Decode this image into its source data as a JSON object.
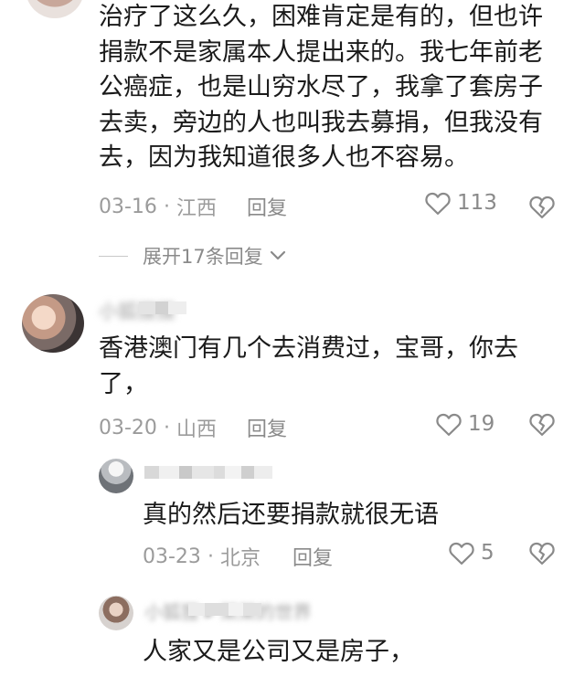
{
  "comments": [
    {
      "text": "治疗了这么久，困难肯定是有的，但也许\n捐款不是家属本人提出来的。我七年前老\n公癌症，也是山穷水尽了，我拿了套房子\n去卖，旁边的人也叫我去募捐，但我没有\n去，因为我知道很多人也不容易。",
      "date": "03-16",
      "location": "江西",
      "reply_label": "回复",
      "likes": "113"
    },
    {
      "username": "小狐狸狸",
      "text": "香港澳门有几个去消费过，宝哥，你去\n了，",
      "date": "03-20",
      "location": "山西",
      "reply_label": "回复",
      "likes": "19"
    }
  ],
  "expand_replies_label": "展开17条回复",
  "replies": [
    {
      "username": "",
      "text": "真的然后还要捐款就很无语",
      "date": "03-23",
      "location": "北京",
      "reply_label": "回复",
      "likes": "5"
    },
    {
      "username": "小狐狸 ▸ 某某的世界",
      "text": "人家又是公司又是房子，"
    }
  ],
  "colors": {
    "text": "#1a1a1a",
    "meta": "#9b9b9b",
    "icon": "#8a8a8a"
  }
}
